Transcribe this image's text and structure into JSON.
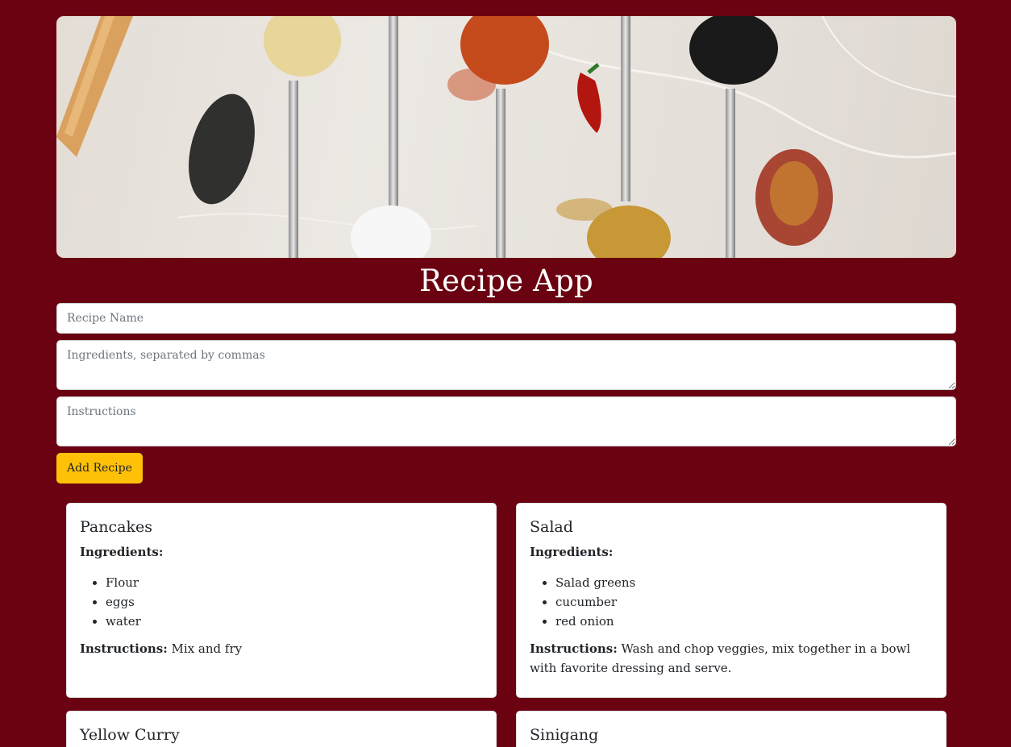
{
  "app": {
    "title": "Recipe App"
  },
  "form": {
    "name_placeholder": "Recipe Name",
    "ingredients_placeholder": "Ingredients, separated by commas",
    "instructions_placeholder": "Instructions",
    "add_label": "Add Recipe"
  },
  "labels": {
    "ingredients": "Ingredients:",
    "instructions": "Instructions:"
  },
  "recipes": [
    {
      "name": "Pancakes",
      "ingredients": [
        "Flour",
        "eggs",
        "water"
      ],
      "instructions": "Mix and fry"
    },
    {
      "name": "Salad",
      "ingredients": [
        "Salad greens",
        "cucumber",
        "red onion"
      ],
      "instructions": "Wash and chop veggies, mix together in a bowl with favorite dressing and serve."
    },
    {
      "name": "Yellow Curry"
    },
    {
      "name": "Sinigang"
    }
  ],
  "colors": {
    "background": "#6b0211",
    "accent": "#ffc107"
  },
  "icons": {
    "hero": "spices-on-spoons-image"
  }
}
